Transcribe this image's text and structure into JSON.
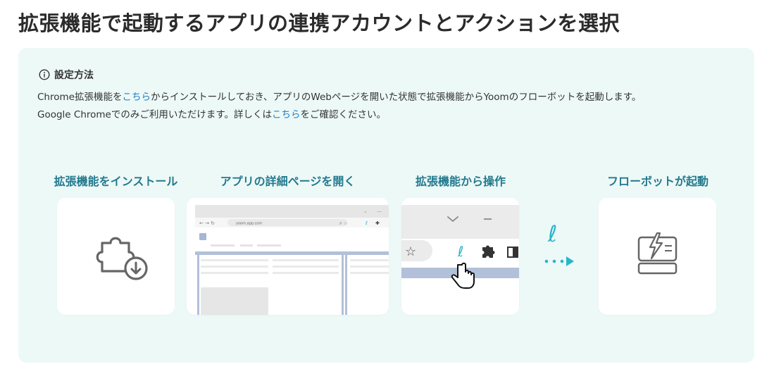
{
  "page": {
    "title": "拡張機能で起動するアプリの連携アカウントとアクションを選択"
  },
  "howto": {
    "title": "設定方法",
    "line1_pre": "Chrome拡張機能を",
    "line1_link": "こちら",
    "line1_post": "からインストールしておき、アプリのWebページを開いた状態で拡張機能からYoomのフローボットを起動します。",
    "line2_pre": "Google Chromeでのみご利用いただけます。詳しくは",
    "line2_link": "こちら",
    "line2_post": "をご確認ください。"
  },
  "steps": [
    {
      "title": "拡張機能をインストール",
      "icon": "puzzle-download-icon"
    },
    {
      "title": "アプリの詳細ページを開く",
      "icon": "browser-window-icon"
    },
    {
      "title": "拡張機能から操作",
      "icon": "extension-toolbar-icon"
    },
    {
      "title": "フローボットが起動",
      "icon": "flowbot-icon"
    }
  ],
  "browser_mock": {
    "url": "yoom.app.com"
  },
  "colors": {
    "panel_bg": "#edf9f7",
    "step_title": "#23798f",
    "link": "#1f7fc8",
    "accent": "#2bb5c9"
  }
}
